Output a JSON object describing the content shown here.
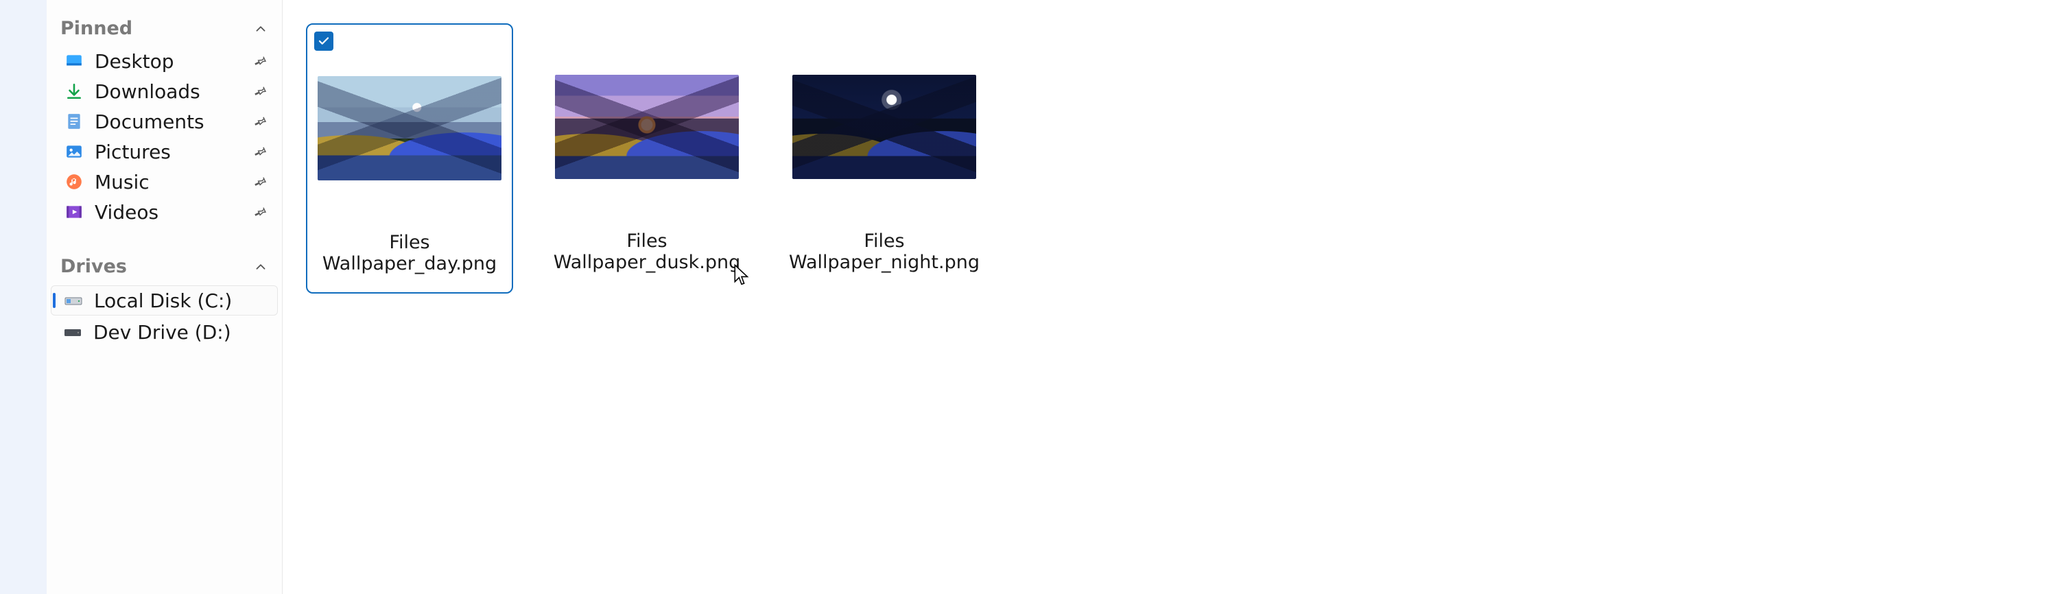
{
  "sidebar": {
    "pinned_header": "Pinned",
    "drives_header": "Drives",
    "pinned": [
      {
        "label": "Desktop",
        "icon": "desktop"
      },
      {
        "label": "Downloads",
        "icon": "downloads"
      },
      {
        "label": "Documents",
        "icon": "documents"
      },
      {
        "label": "Pictures",
        "icon": "pictures"
      },
      {
        "label": "Music",
        "icon": "music"
      },
      {
        "label": "Videos",
        "icon": "videos"
      }
    ],
    "drives": [
      {
        "label": "Local Disk (C:)",
        "selected": true
      },
      {
        "label": "Dev Drive (D:)",
        "selected": false
      }
    ]
  },
  "files": [
    {
      "name": "Files Wallpaper_day.png",
      "variant": "day",
      "selected": true
    },
    {
      "name": "Files Wallpaper_dusk.png",
      "variant": "dusk",
      "selected": false
    },
    {
      "name": "Files Wallpaper_night.png",
      "variant": "night",
      "selected": false
    }
  ],
  "colors": {
    "accent": "#0f6cbd"
  }
}
